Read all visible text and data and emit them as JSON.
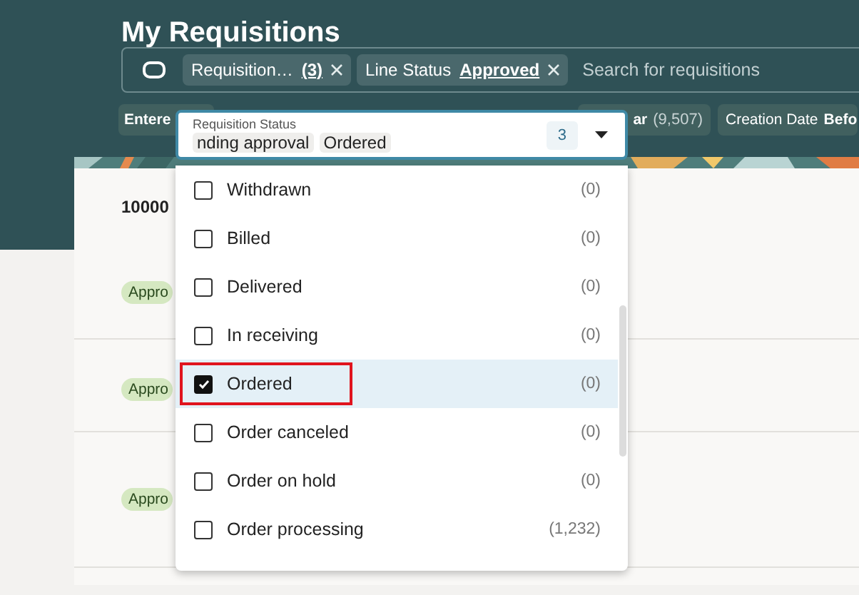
{
  "page": {
    "title": "My Requisitions"
  },
  "search": {
    "chips": [
      {
        "label": "Requisition…",
        "value": "(3)"
      },
      {
        "label": "Line Status",
        "value": "Approved"
      }
    ],
    "placeholder": "Search for requisitions"
  },
  "filter_chips": [
    {
      "label": "Entere"
    },
    {
      "label": "ar",
      "count": "(9,507)"
    },
    {
      "label": "Creation Date",
      "value": "Befo"
    }
  ],
  "requisitions": [
    {
      "number": "10000",
      "status": "Appro"
    },
    {
      "status": "Appro"
    },
    {
      "status": "Appro"
    }
  ],
  "status_dropdown": {
    "label": "Requisition Status",
    "tags": [
      "nding approval",
      "Ordered"
    ],
    "count": "3",
    "options": [
      {
        "label": "Withdrawn",
        "count": "(0)",
        "checked": false,
        "selected": false,
        "highlighted": false
      },
      {
        "label": "Billed",
        "count": "(0)",
        "checked": false,
        "selected": false,
        "highlighted": false
      },
      {
        "label": "Delivered",
        "count": "(0)",
        "checked": false,
        "selected": false,
        "highlighted": false
      },
      {
        "label": "In receiving",
        "count": "(0)",
        "checked": false,
        "selected": false,
        "highlighted": false
      },
      {
        "label": "Ordered",
        "count": "(0)",
        "checked": true,
        "selected": true,
        "highlighted": true
      },
      {
        "label": "Order canceled",
        "count": "(0)",
        "checked": false,
        "selected": false,
        "highlighted": false
      },
      {
        "label": "Order on hold",
        "count": "(0)",
        "checked": false,
        "selected": false,
        "highlighted": false
      },
      {
        "label": "Order processing",
        "count": "(1,232)",
        "checked": false,
        "selected": false,
        "highlighted": false
      }
    ]
  }
}
